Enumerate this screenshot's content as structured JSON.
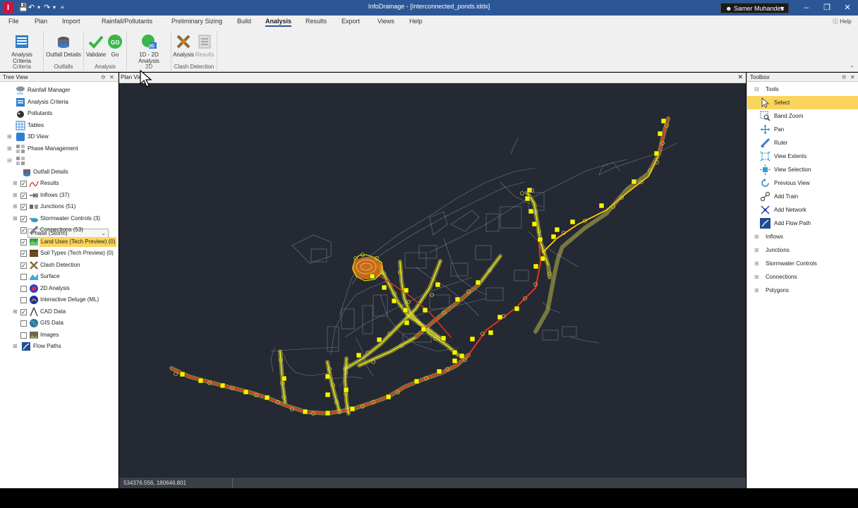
{
  "app": {
    "logo_letter": "I",
    "window_title": "InfoDrainage - [Interconnected_ponds.iddx]",
    "user": "Samer Muhandes"
  },
  "menu": {
    "items": [
      "File",
      "Plan",
      "Import",
      "Rainfall/Pollutants",
      "Preliminary Sizing",
      "Build",
      "Analysis",
      "Results",
      "Export",
      "Views",
      "Help"
    ],
    "active": "Analysis",
    "help": "Help"
  },
  "ribbon": {
    "buttons": {
      "analysis_criteria": "Analysis Criteria",
      "outfall_details": "Outfall Details",
      "validate": "Validate",
      "go": "Go",
      "analysis_1d2d": "1D - 2D Analysis",
      "clash_analysis": "Analysis",
      "clash_results": "Results"
    },
    "groups": {
      "criteria": "Criteria",
      "outfalls": "Outfalls",
      "analysis": "Analysis",
      "twod": "2D",
      "clash": "Clash Detection"
    },
    "icon_text": {
      "go": "GO",
      "twod": "2D"
    }
  },
  "tree": {
    "title": "Tree View",
    "items": {
      "rainfall_manager": "Rainfall Manager",
      "analysis_criteria": "Analysis Criteria",
      "pollutants": "Pollutants",
      "tables": "Tables",
      "view_3d": "3D View",
      "phase_management": "Phase Management",
      "phase": "Phase (Storm)",
      "outfall_details": "Outfall Details",
      "results": "Results",
      "inflows": "Inflows (37)",
      "junctions": "Junctions (51)",
      "stormwater_controls": "Stormwater Controls (3)",
      "connections": "Connections (53)",
      "land_uses": "Land Uses (Tech Preview) (0)",
      "soil_types": "Soil Types (Tech Preview) (0)",
      "clash_detection": "Clash Detection",
      "surface": "Surface",
      "analysis_2d": "2D Analysis",
      "interactive_deluge": "Interactive Deluge (ML)",
      "cad_data": "CAD Data",
      "gis_data": "GIS Data",
      "images": "Images",
      "flow_paths": "Flow Paths"
    }
  },
  "plan": {
    "tab": "Plan View",
    "coordinates": "534376.556, 180646.801"
  },
  "toolbox": {
    "title": "Toolbox",
    "tools_category": "Tools",
    "tools": {
      "select": "Select",
      "band_zoom": "Band Zoom",
      "pan": "Pan",
      "ruler": "Ruler",
      "view_extents": "View Extents",
      "view_selection": "View Selection",
      "previous_view": "Previous View",
      "add_train": "Add Train",
      "add_network": "Add Network",
      "add_flow_path": "Add Flow Path"
    },
    "categories": {
      "inflows": "Inflows",
      "junctions": "Junctions",
      "stormwater_controls": "Stormwater Controls",
      "connections": "Connections",
      "polygons": "Polygons"
    }
  },
  "colors": {
    "titlebar": "#2b5797",
    "highlight": "#fbd55b",
    "plan_bg": "#252933",
    "network_yellow": "#f5f500",
    "network_red": "#e0341e",
    "pond_orange": "#e07a10"
  }
}
